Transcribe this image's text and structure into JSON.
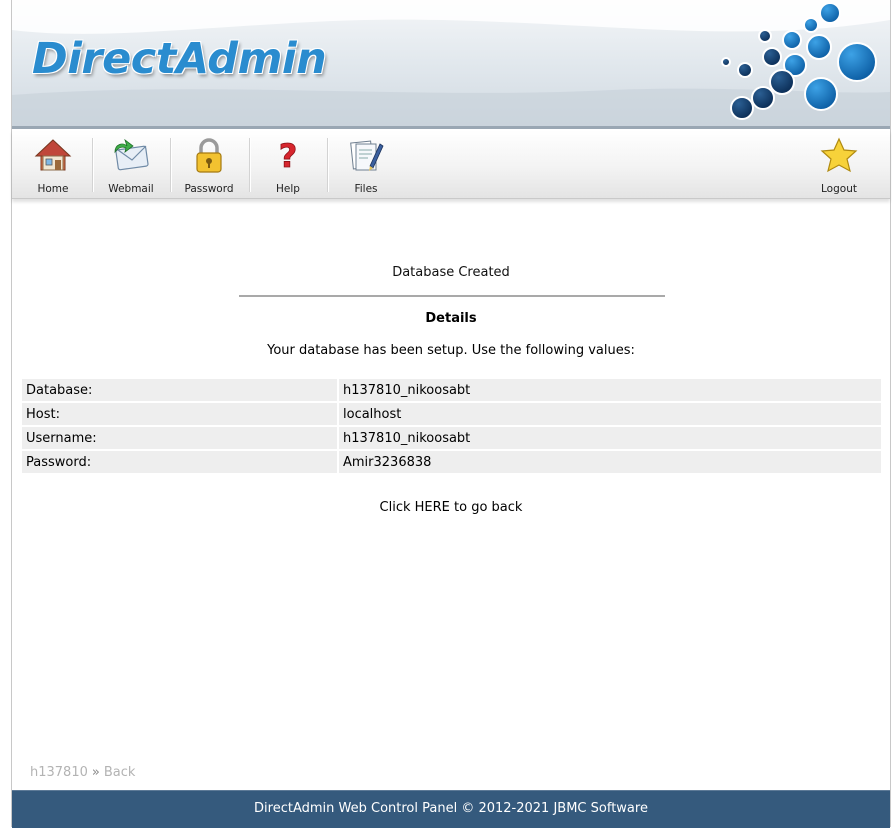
{
  "app": {
    "logo_text": "DirectAdmin"
  },
  "toolbar": {
    "items": [
      {
        "label": "Home",
        "icon": "house-icon"
      },
      {
        "label": "Webmail",
        "icon": "mail-icon"
      },
      {
        "label": "Password",
        "icon": "padlock-icon"
      },
      {
        "label": "Help",
        "icon": "question-mark-icon"
      },
      {
        "label": "Files",
        "icon": "files-icon"
      },
      {
        "label": "Logout",
        "icon": "star-icon"
      }
    ]
  },
  "main": {
    "status_title": "Database Created",
    "details_heading": "Details",
    "setup_text": "Your database has been setup. Use the following values:",
    "values": [
      {
        "key": "Database:",
        "value": "h137810_nikoosabt"
      },
      {
        "key": "Host:",
        "value": "localhost"
      },
      {
        "key": "Username:",
        "value": "h137810_nikoosabt"
      },
      {
        "key": "Password:",
        "value": "Amir3236838"
      }
    ],
    "back_link": "Click HERE to go back"
  },
  "breadcrumb": {
    "user": "h137810",
    "separator": "»",
    "back": "Back"
  },
  "footer": {
    "text": "DirectAdmin Web Control Panel © 2012-2021 JBMC Software"
  },
  "colors": {
    "brand_blue": "#2a8ccf",
    "footer_bg": "#355a7d"
  }
}
